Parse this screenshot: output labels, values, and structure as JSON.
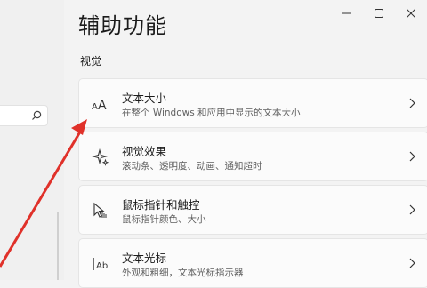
{
  "page": {
    "title": "辅助功能",
    "section": "视觉"
  },
  "settings": [
    {
      "title": "文本大小",
      "subtitle": "在整个 Windows 和应用中显示的文本大小",
      "icon": "text-size-icon"
    },
    {
      "title": "视觉效果",
      "subtitle": "滚动条、透明度、动画、通知超时",
      "icon": "sparkle-icon"
    },
    {
      "title": "鼠标指针和触控",
      "subtitle": "鼠标指针颜色、大小",
      "icon": "mouse-pointer-touch-icon"
    },
    {
      "title": "文本光标",
      "subtitle": "外观和粗细，文本光标指示器",
      "icon": "text-cursor-icon"
    }
  ],
  "colors": {
    "annotation_arrow": "#e0312a",
    "card_bg": "#fbfbfb",
    "page_bg": "#f3f3f3"
  }
}
